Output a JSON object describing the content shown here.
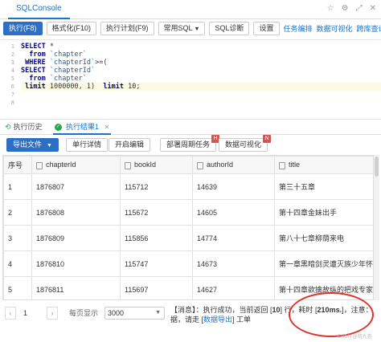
{
  "window": {
    "tab_label": "SQLConsole",
    "icons": [
      "star-icon",
      "settings-icon",
      "expand-icon",
      "close-icon"
    ]
  },
  "toolbar": {
    "run_label": "执行(F8)",
    "format_label": "格式化(F10)",
    "plan_label": "执行计划(F9)",
    "common_sql_label": "常用SQL",
    "diagnose_label": "SQL诊断",
    "settings_label": "设置",
    "task_edit_link": "任务编排",
    "data_viz_link": "数据可视化",
    "cross_db_link": "跨库查询"
  },
  "editor": {
    "line_numbers": [
      "1",
      "2",
      "3",
      "4",
      "5",
      "6",
      "7",
      "8"
    ],
    "lines": {
      "l1_kw": "SELECT",
      "l1_rest": " *",
      "l2_kw": "  from",
      "l2_str": " `chapter`",
      "l3_kw": " WHERE",
      "l3_str": " `chapterId`",
      "l3_rest": ">=(",
      "l4_kw": "SELECT",
      "l4_str": " `chapterId`",
      "l5_kw": "  from",
      "l5_str": " `chapter`",
      "l6_kw": " limit",
      "l6_rest": " 1000000, 1)",
      "l6_kw2": "  limit",
      "l6_rest2": " 10;"
    }
  },
  "bottom_tabs": {
    "history_label": "执行历史",
    "result_label": "执行结果1",
    "result_close": "✕"
  },
  "result_toolbar": {
    "export_label": "导出文件",
    "detail_label": "单行详情",
    "edit_label": "开启编辑",
    "periodic_label": "部署周期任务",
    "periodic_badge": "H",
    "viz_label": "数据可视化",
    "viz_badge": "N"
  },
  "table": {
    "headers": [
      "序号",
      "chapterId",
      "bookId",
      "authorId",
      "title"
    ],
    "rows": [
      [
        "1",
        "1876807",
        "115712",
        "14639",
        "第三十五章"
      ],
      [
        "2",
        "1876808",
        "115672",
        "14605",
        "第十四章金妹出手"
      ],
      [
        "3",
        "1876809",
        "115856",
        "14774",
        "第八十七章柳荫来电"
      ],
      [
        "4",
        "1876810",
        "115747",
        "14673",
        "第一章黑暗剑灵遭灭族少年怀仇"
      ],
      [
        "5",
        "1876811",
        "115697",
        "14627",
        "第十四章欲擒故纵的把戏专家"
      ]
    ]
  },
  "pager": {
    "prev": "‹",
    "page": "1",
    "next": "›",
    "page_size_label": "每页显示",
    "page_size_value": "3000",
    "message": {
      "p1": "【消息】：执行成功，当前返回 [",
      "count": "10",
      "p2": "] 行，耗时 [",
      "time": "210ms.",
      "p3": "]，注意：",
      "p4": "据，请走 [",
      "export_link": "数据导出",
      "p5": "] 工单"
    }
  },
  "watermark": "CSDN @晓九卷"
}
